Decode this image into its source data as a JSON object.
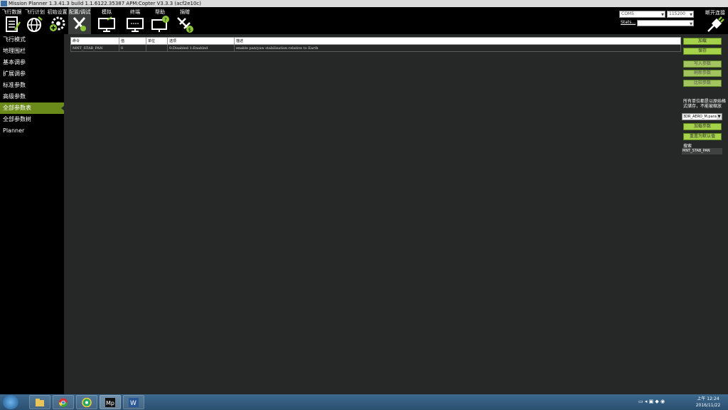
{
  "window": {
    "title": "Mission Planner 1.3.41.3 build 1.1.6122.35387 APM:Copter V3.3.3 (acf2e10c)"
  },
  "menu": [
    {
      "label": "飞行数据",
      "icon": "flight-data-icon"
    },
    {
      "label": "飞行计划",
      "icon": "globe-icon"
    },
    {
      "label": "初始设置",
      "icon": "gear-icon"
    },
    {
      "label": "配置/调试",
      "icon": "wrench-icon"
    },
    {
      "label": "模拟",
      "icon": "simulation-monitor-icon"
    },
    {
      "label": "终端",
      "icon": "terminal-monitor-icon"
    },
    {
      "label": "帮助",
      "icon": "help-monitor-icon"
    },
    {
      "label": "捐赠",
      "icon": "donate-plane-icon"
    }
  ],
  "connection": {
    "port": "COM5",
    "baud": "115200",
    "stats_label": "Stats...",
    "connect_label": "断开连接"
  },
  "sidebar": {
    "items": [
      {
        "label": "飞行模式"
      },
      {
        "label": "地理围栏"
      },
      {
        "label": "基本调参"
      },
      {
        "label": "扩展调参"
      },
      {
        "label": "标准参数"
      },
      {
        "label": "高级参数"
      },
      {
        "label": "全部参数表"
      },
      {
        "label": "全部参数树"
      },
      {
        "label": "Planner"
      }
    ],
    "active_index": 6
  },
  "table": {
    "headers": [
      "命令",
      "值",
      "单位",
      "选项",
      "描述"
    ],
    "rows": [
      [
        "MNT_STAB_PAN",
        "0",
        "",
        "0:Disabled 1:Enabled",
        "enable pan/yaw stabilisation relative to Earth"
      ]
    ]
  },
  "actions": {
    "load": "加载",
    "save": "保存",
    "write": "写入参数",
    "refresh": "刷新参数",
    "compare": "比较参数",
    "info_text": "所有单位都是以原始格式储存，不能被缩放",
    "file_selected": "3DR_AERO_M.param",
    "load_preset": "加载参数",
    "reset_default": "重置为默认值",
    "search_label": "搜索",
    "search_value": "MNT_STAB_PAN"
  },
  "taskbar": {
    "apps": [
      "file-explorer-icon",
      "chrome-icon",
      "media-player-icon",
      "mission-planner-icon",
      "word-icon"
    ],
    "time": "上午 12:24",
    "date": "2016/11/22"
  }
}
